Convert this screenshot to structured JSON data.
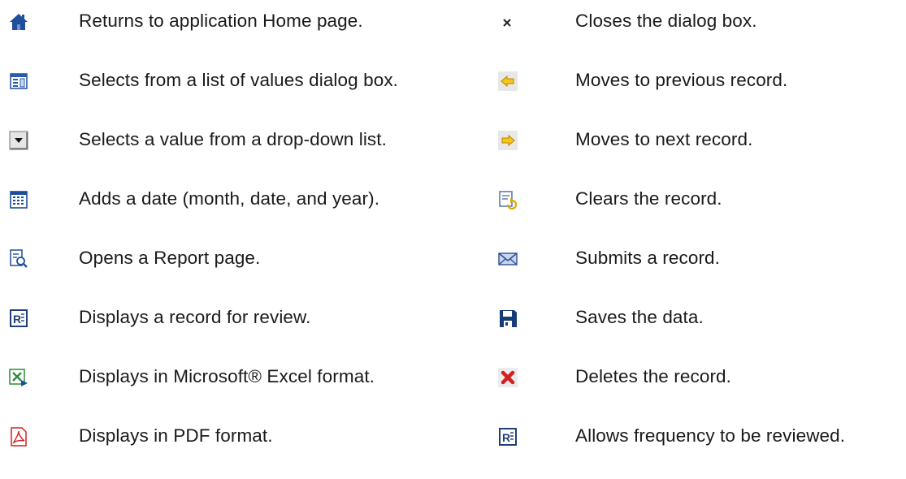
{
  "left_column": [
    {
      "icon": "home-icon",
      "text": "Returns to application Home page."
    },
    {
      "icon": "list-of-values-icon",
      "text": "Selects from a list of values dialog box."
    },
    {
      "icon": "dropdown-arrow-icon",
      "text": "Selects a value from a drop-down list."
    },
    {
      "icon": "calendar-icon",
      "text": "Adds a date (month, date, and year)."
    },
    {
      "icon": "report-magnifier-icon",
      "text": "Opens a Report page."
    },
    {
      "icon": "review-record-icon",
      "text": "Displays a record for review."
    },
    {
      "icon": "excel-export-icon",
      "text": "Displays in Microsoft® Excel format."
    },
    {
      "icon": "pdf-icon",
      "text": "Displays in PDF format."
    }
  ],
  "right_column": [
    {
      "icon": "close-icon",
      "text": "Closes the dialog box."
    },
    {
      "icon": "previous-arrow-icon",
      "text": "Moves to previous record."
    },
    {
      "icon": "next-arrow-icon",
      "text": "Moves to next record."
    },
    {
      "icon": "clear-record-icon",
      "text": "Clears the record."
    },
    {
      "icon": "submit-envelope-icon",
      "text": "Submits a record."
    },
    {
      "icon": "save-disk-icon",
      "text": "Saves the data."
    },
    {
      "icon": "delete-x-icon",
      "text": "Deletes the record."
    },
    {
      "icon": "frequency-review-icon",
      "text": "Allows frequency to be reviewed."
    }
  ],
  "colors": {
    "text": "#1a1a1a",
    "icon_blue": "#1f4e9c",
    "icon_red": "#d42020",
    "arrow_yellow": "#f5c518",
    "excel_green": "#2e8b3a"
  }
}
